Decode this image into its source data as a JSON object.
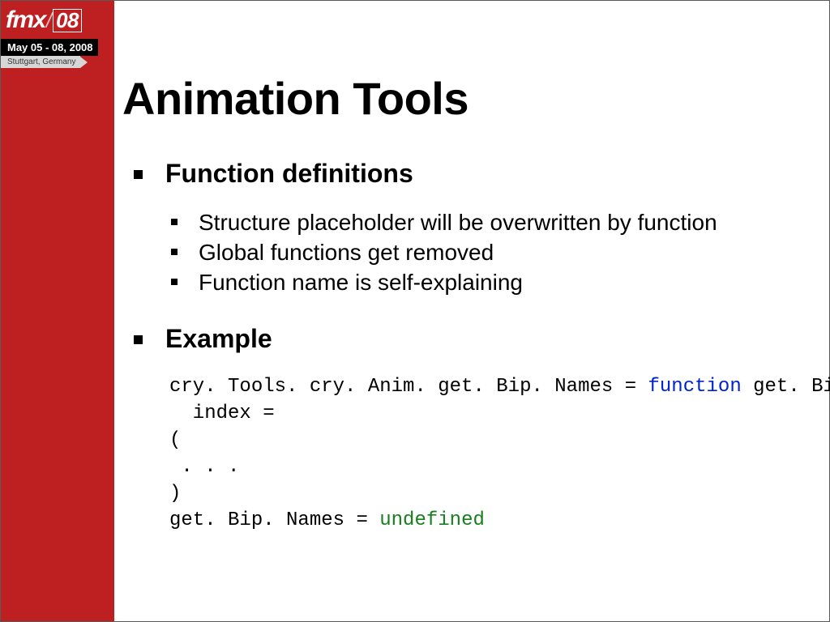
{
  "logo": {
    "brand": "fmx",
    "slash": "/",
    "year": "08",
    "dates": "May 05 - 08, 2008",
    "location": "Stuttgart, Germany"
  },
  "title": "Animation Tools",
  "section1": {
    "heading": "Function definitions",
    "items": [
      "Structure placeholder will be overwritten by function",
      "Global functions get removed",
      "Function name is self-explaining"
    ]
  },
  "section2": {
    "heading": "Example",
    "code": {
      "l1a": "cry. Tools. cry. Anim. get. Bip. Names = ",
      "l1b": "function",
      "l1c": " get. Bip. Names",
      "l2": "  index =",
      "l3": "(",
      "l4": " . . .",
      "l5": ")",
      "l6a": "get. Bip. Names = ",
      "l6b": "undefined"
    }
  }
}
